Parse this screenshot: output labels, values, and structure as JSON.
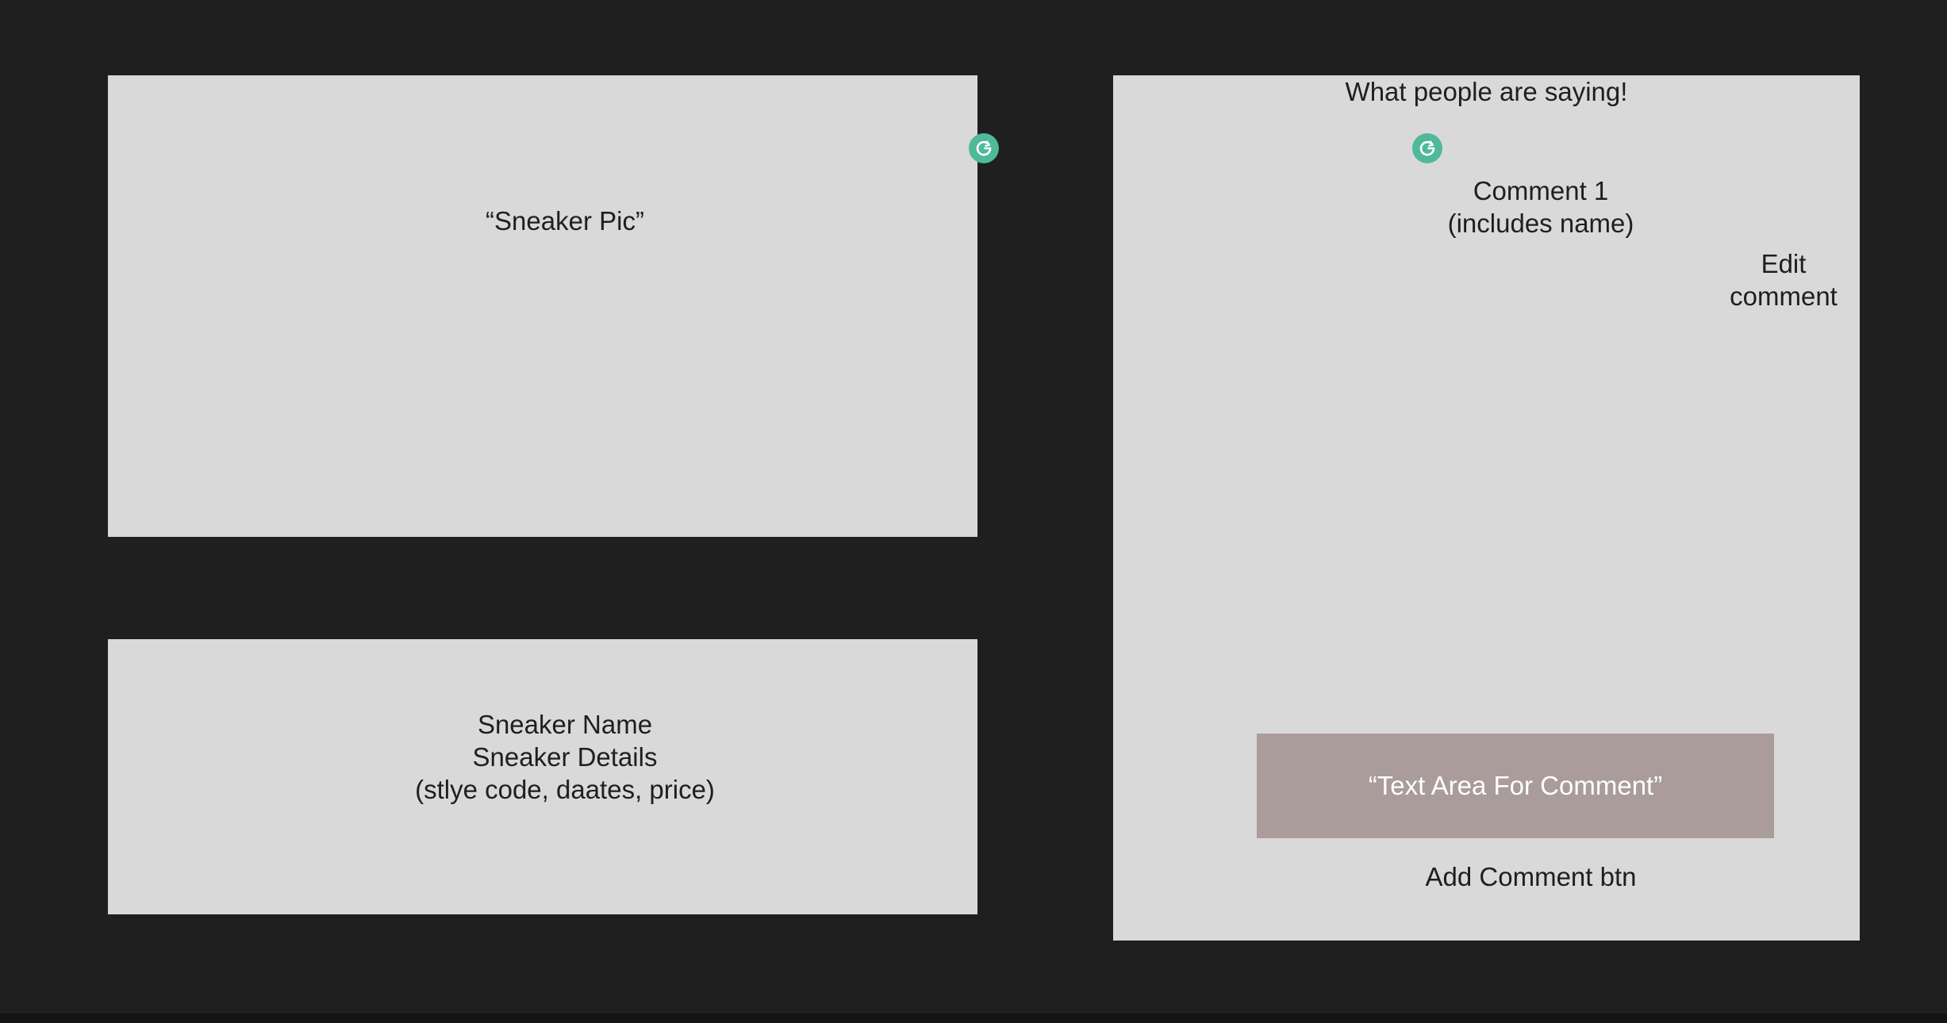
{
  "left_column": {
    "pic_label": "“Sneaker Pic”",
    "details_lines": [
      "Sneaker Name",
      "Sneaker Details",
      "(stlye code, daates, price)"
    ]
  },
  "comments": {
    "title": "What people are saying!",
    "comment_1_lines": [
      "Comment 1",
      "(includes name)"
    ],
    "edit_lines": [
      "Edit",
      "comment"
    ],
    "textarea_label": "“Text Area For Comment”",
    "add_button_label": "Add Comment btn"
  },
  "colors": {
    "canvas": "#1f1f1f",
    "frame": "#d9d9d9",
    "textarea": "#a99c9b",
    "badge": "#4fb99a"
  },
  "icons": [
    "grammarly-icon"
  ]
}
